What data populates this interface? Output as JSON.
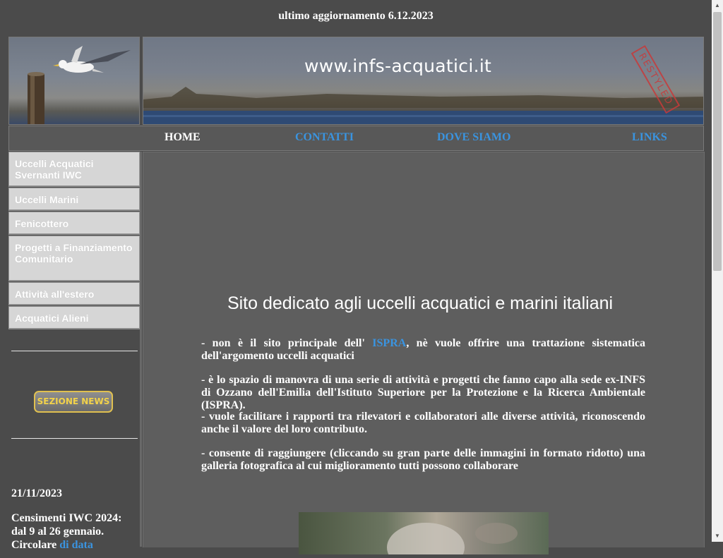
{
  "header": {
    "update_text": "ultimo aggiornamento 6.12.2023"
  },
  "banner": {
    "site_title": "www.infs-acquatici.it",
    "stamp_text": "RESTYLED"
  },
  "nav": {
    "items": [
      {
        "label": "HOME",
        "active": true
      },
      {
        "label": "CONTATTI"
      },
      {
        "label": "DOVE SIAMO"
      },
      {
        "label": "LINKS"
      }
    ]
  },
  "sidebar": {
    "menu": [
      "Uccelli Acquatici Svernanti IWC",
      "Uccelli Marini",
      "Fenicottero",
      "Progetti a Finanziamento Comunitario",
      "Attività all'estero",
      "Acquatici Alieni"
    ],
    "news_button": "SEZIONE NEWS",
    "news_date": "21/11/2023",
    "news_text": "Censimenti IWC 2024: dal 9 al 26 gennaio.",
    "news_text_cont": "Circolare",
    "news_text_link": "di data"
  },
  "main": {
    "title": "Sito dedicato agli uccelli acquatici e marini italiani",
    "p1_pre": "- non è il sito principale dell' ",
    "p1_link": "ISPRA",
    "p1_post": ", nè vuole offrire una trattazione sistematica dell'argomento uccelli acquatici",
    "p2": "- è lo spazio di manovra di una serie di attività e progetti che fanno capo alla sede ex-INFS di Ozzano dell'Emilia dell'Istituto Superiore per la Protezione e la Ricerca Ambientale (ISPRA).",
    "p3": "- vuole facilitare i rapporti tra rilevatori e collaboratori alle diverse attività, riconoscendo anche il valore del loro contributo.",
    "p4": "- consente di raggiungere (cliccando su gran parte delle immagini in formato ridotto) una galleria fotografica al cui miglioramento tutti possono collaborare"
  },
  "colors": {
    "link": "#3a94e0",
    "background": "#4b4b4b",
    "content_bg": "#5e5e5e",
    "menu_bg": "#d6d6d6",
    "news_gold": "#f2d24a"
  }
}
